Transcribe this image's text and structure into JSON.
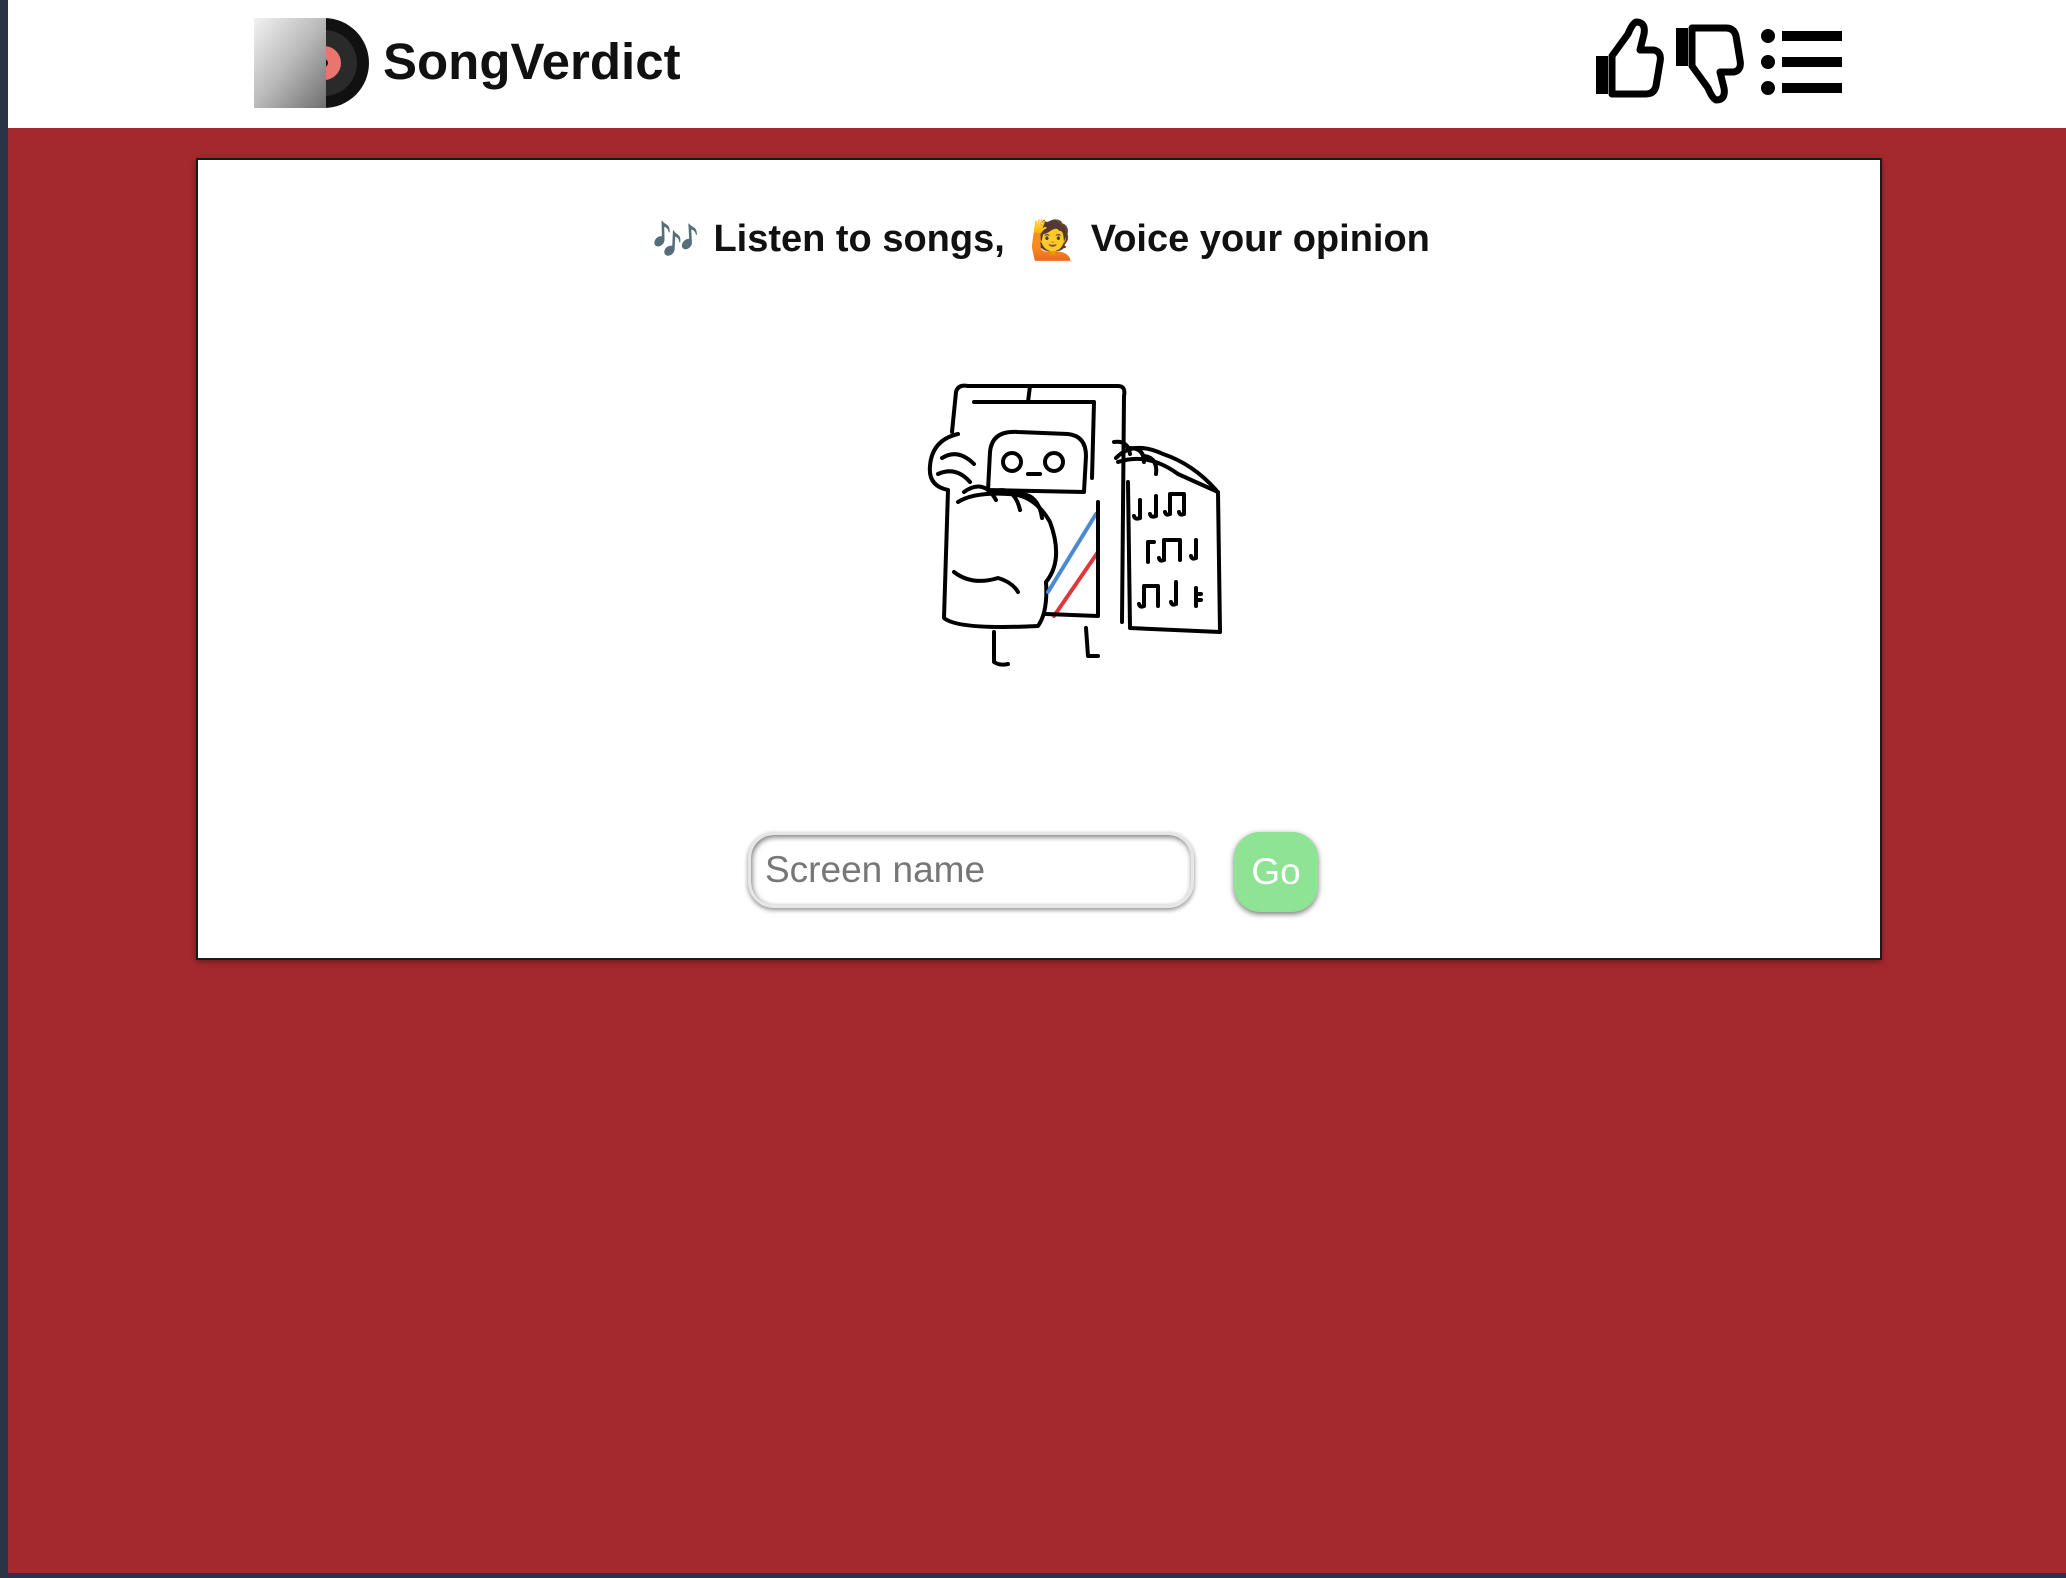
{
  "header": {
    "brand": "SongVerdict",
    "nav": [
      {
        "icon": "thumbs-up-icon"
      },
      {
        "icon": "thumbs-down-icon"
      },
      {
        "icon": "list-icon"
      }
    ]
  },
  "hero": {
    "tagline_part1": "Listen to songs,",
    "tagline_part2": "Voice your opinion",
    "emoji_1": "🎶",
    "emoji_2": "🙋"
  },
  "form": {
    "screen_name_placeholder": "Screen name",
    "screen_name_value": "",
    "go_label": "Go"
  },
  "colors": {
    "page_background": "#a4292e",
    "go_button": "#8fe395",
    "header_background": "#ffffff"
  }
}
